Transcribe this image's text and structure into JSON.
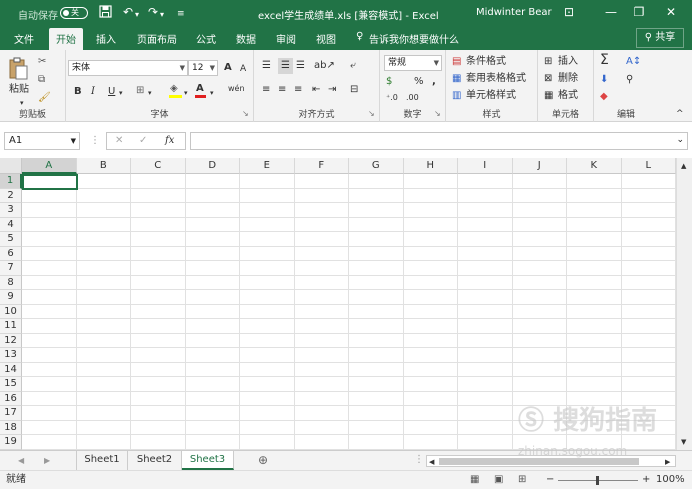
{
  "titlebar": {
    "autosave_label": "自动保存",
    "autosave_state": "关",
    "document_title": "excel学生成绩单.xls  [兼容模式]  -  Excel",
    "user_name": "Midwinter Bear",
    "minimize": "—",
    "restore": "❐",
    "close": "✕",
    "ribbon_display": "⊡",
    "save_icon": "save-icon",
    "undo_icon": "undo-icon",
    "redo_icon": "redo-icon"
  },
  "tabs": [
    "文件",
    "开始",
    "插入",
    "页面布局",
    "公式",
    "数据",
    "审阅",
    "视图"
  ],
  "active_tab": "开始",
  "tell_me": "告诉我你想要做什么",
  "share_label": "共享",
  "ribbon": {
    "clipboard": {
      "paste": "粘贴",
      "label": "剪贴板"
    },
    "font": {
      "name": "宋体",
      "size": "12",
      "bold": "B",
      "italic": "I",
      "underline": "U",
      "grow": "A",
      "shrink": "A",
      "pinyin": "wén",
      "label": "字体"
    },
    "alignment": {
      "label": "对齐方式"
    },
    "number": {
      "format": "常规",
      "percent": "%",
      "comma": ",",
      "label": "数字"
    },
    "styles": {
      "conditional": "条件格式",
      "table": "套用表格格式",
      "cell": "单元格样式",
      "label": "样式"
    },
    "cells": {
      "insert": "插入",
      "delete": "删除",
      "format": "格式",
      "label": "单元格"
    },
    "editing": {
      "label": "编辑"
    }
  },
  "formula_bar": {
    "name_box": "A1",
    "fx": "fx",
    "cancel": "✕",
    "enter": "✓",
    "value": ""
  },
  "columns": [
    "A",
    "B",
    "C",
    "D",
    "E",
    "F",
    "G",
    "H",
    "I",
    "J",
    "K",
    "L"
  ],
  "rows": [
    "1",
    "2",
    "3",
    "4",
    "5",
    "6",
    "7",
    "8",
    "9",
    "10",
    "11",
    "12",
    "13",
    "14",
    "15",
    "16",
    "17",
    "18",
    "19"
  ],
  "selected_cell": {
    "column": "A",
    "row": "1"
  },
  "sheets": [
    "Sheet1",
    "Sheet2",
    "Sheet3"
  ],
  "active_sheet": "Sheet3",
  "add_sheet": "⊕",
  "status": {
    "ready": "就绪",
    "zoom": "100%",
    "zoom_minus": "−",
    "zoom_plus": "+"
  },
  "watermark": {
    "text": "搜狗指南",
    "url": "zhinan.sogou.com"
  }
}
